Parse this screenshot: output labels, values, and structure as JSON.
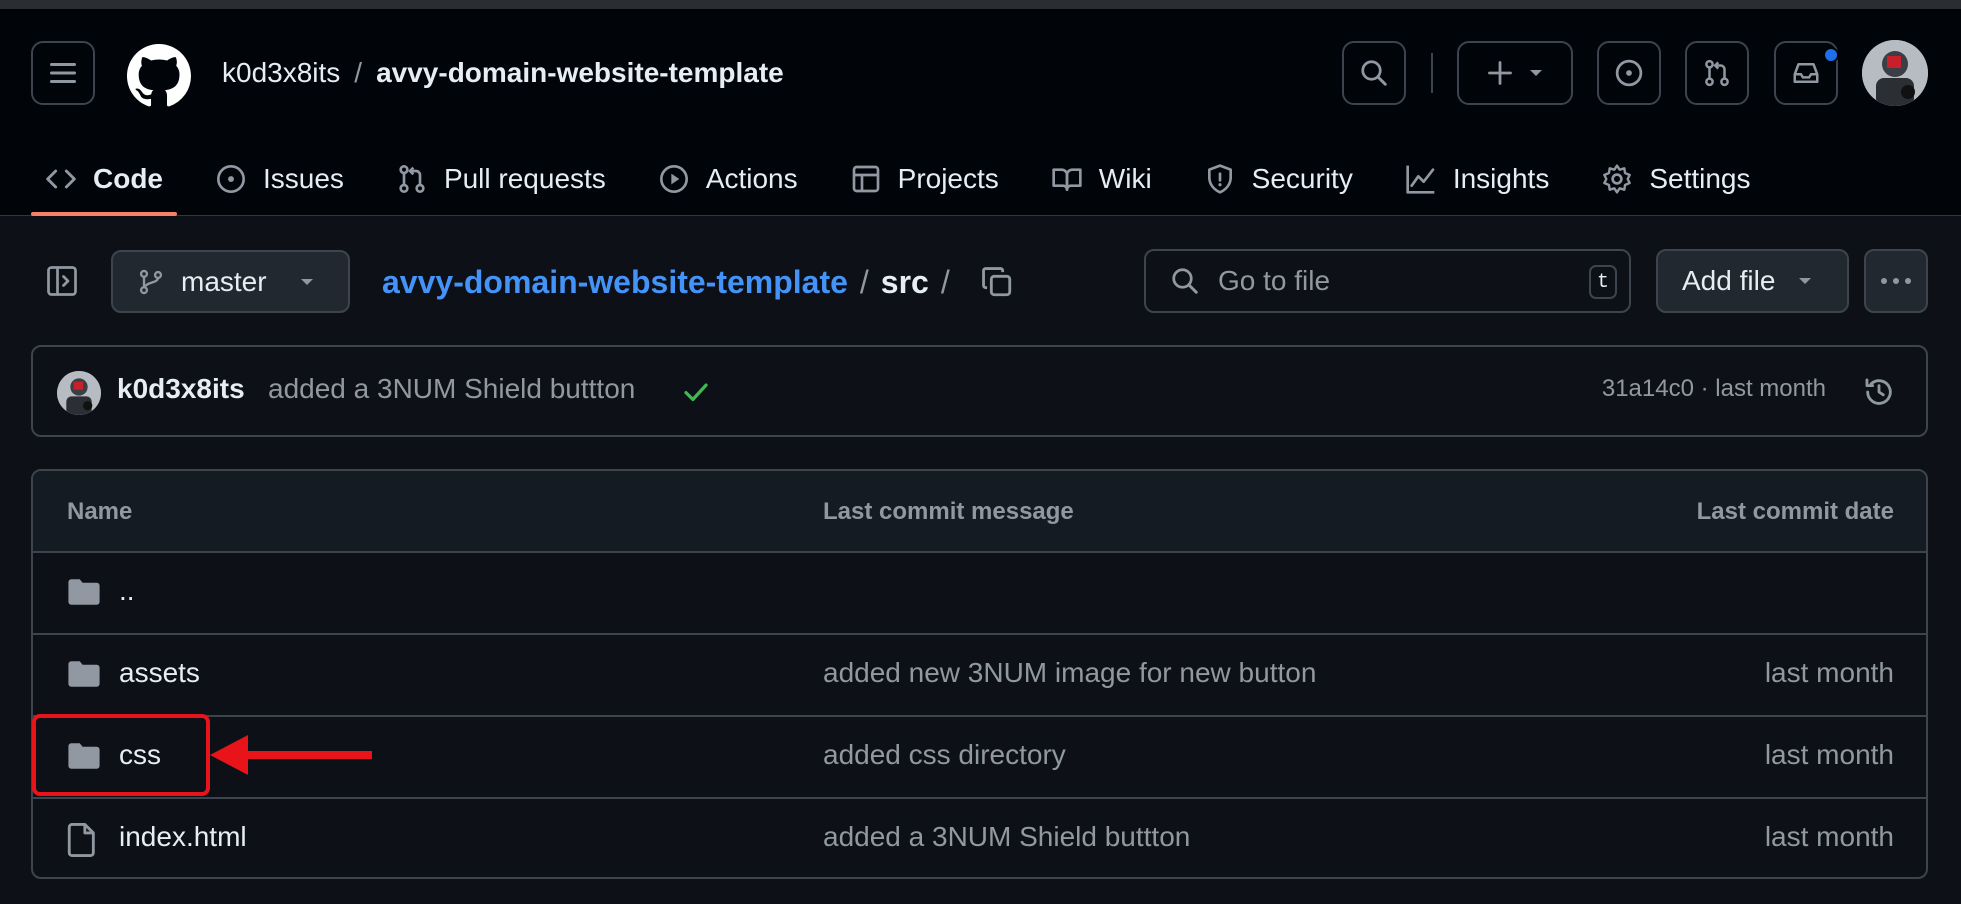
{
  "header": {
    "owner": "k0d3x8its",
    "separator": "/",
    "repo": "avvy-domain-website-template",
    "icons": [
      "hamburger-icon",
      "github-logo",
      "search-icon",
      "plus-icon",
      "triangle-down-icon",
      "issue-opened-icon",
      "git-pull-request-icon",
      "inbox-icon",
      "avatar"
    ],
    "notification_dot_color": "#1f6feb"
  },
  "tabs": [
    {
      "label": "Code",
      "icon": "code-icon",
      "active": true
    },
    {
      "label": "Issues",
      "icon": "issue-opened-icon"
    },
    {
      "label": "Pull requests",
      "icon": "git-pull-request-icon"
    },
    {
      "label": "Actions",
      "icon": "play-icon"
    },
    {
      "label": "Projects",
      "icon": "table-icon"
    },
    {
      "label": "Wiki",
      "icon": "book-icon"
    },
    {
      "label": "Security",
      "icon": "shield-icon"
    },
    {
      "label": "Insights",
      "icon": "graph-icon"
    },
    {
      "label": "Settings",
      "icon": "gear-icon"
    }
  ],
  "repo_nav": {
    "branch": "master",
    "breadcrumb_repo": "avvy-domain-website-template",
    "breadcrumb_sep": "/",
    "breadcrumb_dir": "src",
    "breadcrumb_trailing": "/",
    "goto_placeholder": "Go to file",
    "goto_shortcut": "t",
    "add_file_label": "Add file"
  },
  "latest_commit": {
    "author": "k0d3x8its",
    "message": "added a 3NUM Shield buttton",
    "status": "success",
    "meta": "31a14c0 · last month"
  },
  "file_table": {
    "columns": [
      "Name",
      "Last commit message",
      "Last commit date"
    ],
    "rows": [
      {
        "type": "folder",
        "name": "..",
        "message": "",
        "date": ""
      },
      {
        "type": "folder",
        "name": "assets",
        "message": "added new 3NUM image for new button",
        "date": "last month"
      },
      {
        "type": "folder",
        "name": "css",
        "message": "added css directory",
        "date": "last month"
      },
      {
        "type": "file",
        "name": "index.html",
        "message": "added a 3NUM Shield buttton",
        "date": "last month"
      }
    ]
  },
  "annotation": {
    "color": "#e8141a",
    "target": "css"
  },
  "colors": {
    "accent_link": "#4493f8",
    "tab_underline": "#f78166",
    "success": "#3fb950"
  }
}
